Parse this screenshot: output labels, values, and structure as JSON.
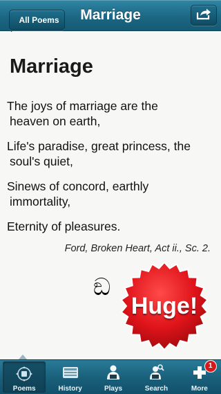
{
  "navbar": {
    "back_label": "All Poems",
    "title": "Marriage",
    "share_icon": "share-icon"
  },
  "poem": {
    "title": "Marriage",
    "stanzas": [
      {
        "line1": "The joys of marriage are the",
        "line2": "heaven on earth,"
      },
      {
        "line1": "Life's paradise, great princess, the",
        "line2": "soul's quiet,"
      },
      {
        "line1": "Sinews of concord, earthly",
        "line2": "immortality,"
      },
      {
        "line1": "Eternity of pleasures.",
        "line2": ""
      }
    ],
    "attribution": "Ford, Broken Heart, Act ii., Sc. 2.",
    "ornament": "ඞ"
  },
  "promo": {
    "label": "Huge!",
    "color": "#e0151b"
  },
  "tabbar": {
    "tabs": [
      {
        "label": "Poems",
        "icon": "poems-icon",
        "active": true
      },
      {
        "label": "History",
        "icon": "history-icon",
        "active": false
      },
      {
        "label": "Plays",
        "icon": "plays-icon",
        "active": false
      },
      {
        "label": "Search",
        "icon": "search-icon",
        "active": false
      },
      {
        "label": "More",
        "icon": "more-icon",
        "active": false,
        "badge": "1"
      }
    ]
  }
}
